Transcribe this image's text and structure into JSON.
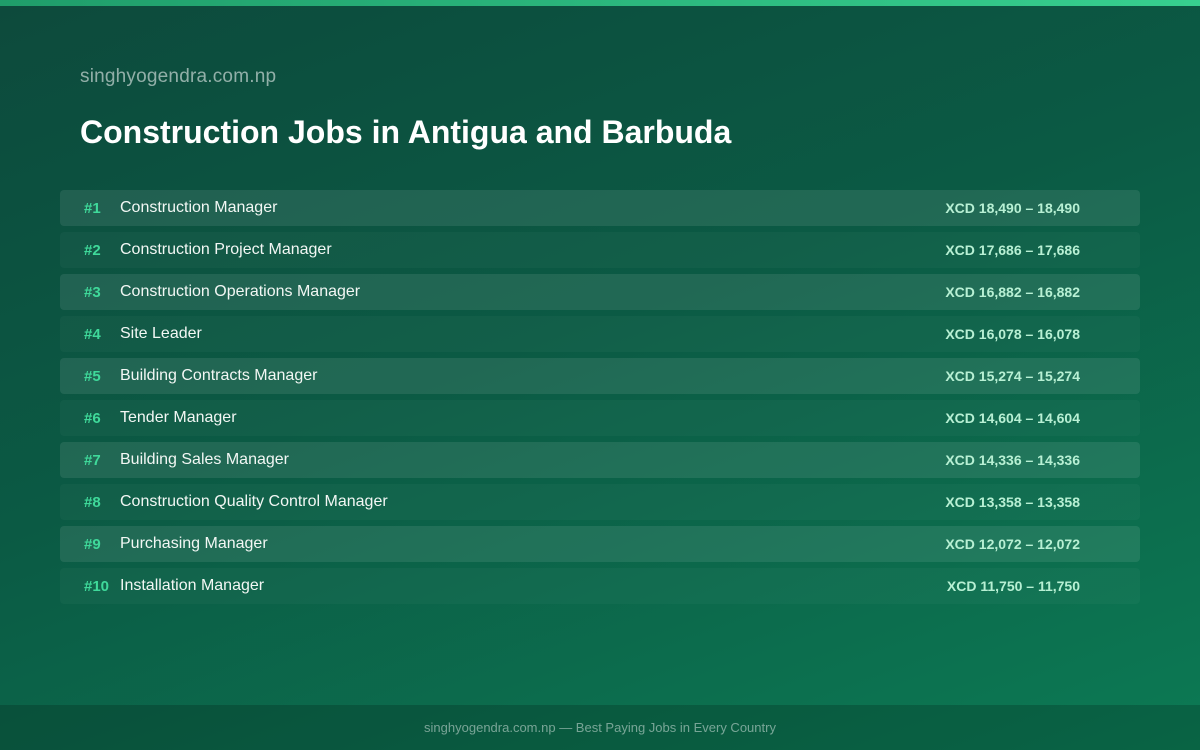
{
  "site_name": "singhyogendra.com.np",
  "title": "Construction Jobs in Antigua and Barbuda",
  "jobs": [
    {
      "rank": "#1",
      "title": "Construction Manager",
      "salary": "XCD 18,490 – 18,490"
    },
    {
      "rank": "#2",
      "title": "Construction Project Manager",
      "salary": "XCD 17,686 – 17,686"
    },
    {
      "rank": "#3",
      "title": "Construction Operations Manager",
      "salary": "XCD 16,882 – 16,882"
    },
    {
      "rank": "#4",
      "title": "Site Leader",
      "salary": "XCD 16,078 – 16,078"
    },
    {
      "rank": "#5",
      "title": "Building Contracts Manager",
      "salary": "XCD 15,274 – 15,274"
    },
    {
      "rank": "#6",
      "title": "Tender Manager",
      "salary": "XCD 14,604 – 14,604"
    },
    {
      "rank": "#7",
      "title": "Building Sales Manager",
      "salary": "XCD 14,336 – 14,336"
    },
    {
      "rank": "#8",
      "title": "Construction Quality Control Manager",
      "salary": "XCD 13,358 – 13,358"
    },
    {
      "rank": "#9",
      "title": "Purchasing Manager",
      "salary": "XCD 12,072 – 12,072"
    },
    {
      "rank": "#10",
      "title": "Installation Manager",
      "salary": "XCD 11,750 – 11,750"
    }
  ],
  "footer": "singhyogendra.com.np — Best Paying Jobs in Every Country",
  "colors": {
    "accent": "#3fd99a",
    "background_start": "#0d4a3c",
    "background_end": "#0c7a54",
    "top_bar": "#37d08f"
  }
}
